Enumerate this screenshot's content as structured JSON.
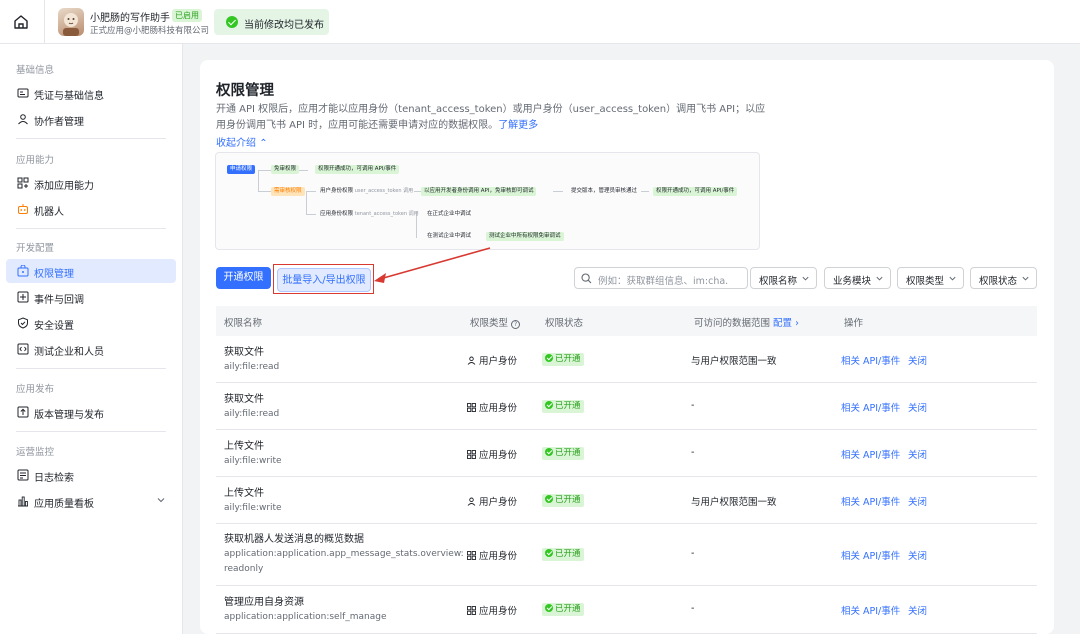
{
  "header": {
    "app_name": "小肥肠的写作助手",
    "app_badge": "已启用",
    "app_subtitle": "正式应用@小肥肠科技有限公司",
    "toast": "当前修改均已发布"
  },
  "sidebar": {
    "sections": [
      {
        "title": "基础信息"
      },
      {
        "title": "应用能力"
      },
      {
        "title": "开发配置"
      },
      {
        "title": "应用发布"
      },
      {
        "title": "运营监控"
      }
    ],
    "items": [
      {
        "label": "凭证与基础信息",
        "icon": "id-card-icon"
      },
      {
        "label": "协作者管理",
        "icon": "user-icon"
      },
      {
        "label": "添加应用能力",
        "icon": "grid-add-icon"
      },
      {
        "label": "机器人",
        "icon": "robot-icon"
      },
      {
        "label": "权限管理",
        "icon": "key-icon",
        "active": true
      },
      {
        "label": "事件与回调",
        "icon": "event-icon"
      },
      {
        "label": "安全设置",
        "icon": "shield-icon"
      },
      {
        "label": "测试企业和人员",
        "icon": "code-icon"
      },
      {
        "label": "版本管理与发布",
        "icon": "upload-icon"
      },
      {
        "label": "日志检索",
        "icon": "log-icon"
      },
      {
        "label": "应用质量看板",
        "icon": "bar-chart-icon"
      }
    ]
  },
  "main": {
    "title": "权限管理",
    "description": "开通 API 权限后，应用才能以应用身份（tenant_access_token）或用户身份（user_access_token）调用飞书 API；以应用身份调用飞书 API 时，应用可能还需要申请对应的数据权限。",
    "learn_more": "了解更多",
    "collapse": "收起介绍",
    "flow": {
      "apply": "申请权限",
      "no_review": "免审权限",
      "no_review_result": "权限开通成功，可调用 API/事件",
      "review": "需审核权限",
      "user_perm": "用户身份权限",
      "user_token": "user_access_token 调用",
      "tenant_perm": "应用身份权限",
      "tenant_token": "tenant_access_token 调用",
      "dev_call": "以应用开发者身份调用 API，免审核即可调试",
      "submit": "提交版本，管理员审核通过",
      "success": "权限开通成功，可调用 API/事件",
      "prod_debug": "在正式企业中调试",
      "test_debug": "在测试企业中调试",
      "test_result": "测试企业中所有权限免审调试"
    },
    "buttons": {
      "enable": "开通权限",
      "batch": "批量导入/导出权限"
    },
    "search_placeholder": "例如：获取群组信息、im:cha...",
    "filters": [
      "权限名称",
      "业务模块",
      "权限类型",
      "权限状态"
    ],
    "table": {
      "headers": {
        "name": "权限名称",
        "type": "权限类型",
        "status": "权限状态",
        "scope": "可访问的数据范围",
        "scope_link": "配置",
        "ops": "操作"
      },
      "rows": [
        {
          "name": "获取文件",
          "code": "aily:file:read",
          "type": "用户身份",
          "type_icon": "user-icon",
          "status": "已开通",
          "scope": "与用户权限范围一致",
          "op1": "相关 API/事件",
          "op2": "关闭"
        },
        {
          "name": "获取文件",
          "code": "aily:file:read",
          "type": "应用身份",
          "type_icon": "app-grid-icon",
          "status": "已开通",
          "scope": "-",
          "op1": "相关 API/事件",
          "op2": "关闭"
        },
        {
          "name": "上传文件",
          "code": "aily:file:write",
          "type": "应用身份",
          "type_icon": "app-grid-icon",
          "status": "已开通",
          "scope": "-",
          "op1": "相关 API/事件",
          "op2": "关闭"
        },
        {
          "name": "上传文件",
          "code": "aily:file:write",
          "type": "用户身份",
          "type_icon": "user-icon",
          "status": "已开通",
          "scope": "与用户权限范围一致",
          "op1": "相关 API/事件",
          "op2": "关闭"
        },
        {
          "name": "获取机器人发送消息的概览数据",
          "code": "application:application.app_message_stats.overview:readonly",
          "type": "应用身份",
          "type_icon": "app-grid-icon",
          "status": "已开通",
          "scope": "-",
          "op1": "相关 API/事件",
          "op2": "关闭"
        },
        {
          "name": "管理应用自身资源",
          "code": "application:application:self_manage",
          "type": "应用身份",
          "type_icon": "app-grid-icon",
          "status": "已开通",
          "scope": "-",
          "op1": "相关 API/事件",
          "op2": "关闭"
        }
      ]
    }
  },
  "colors": {
    "accent": "#3370ff",
    "success": "#34c724",
    "highlight": "#d83931"
  }
}
